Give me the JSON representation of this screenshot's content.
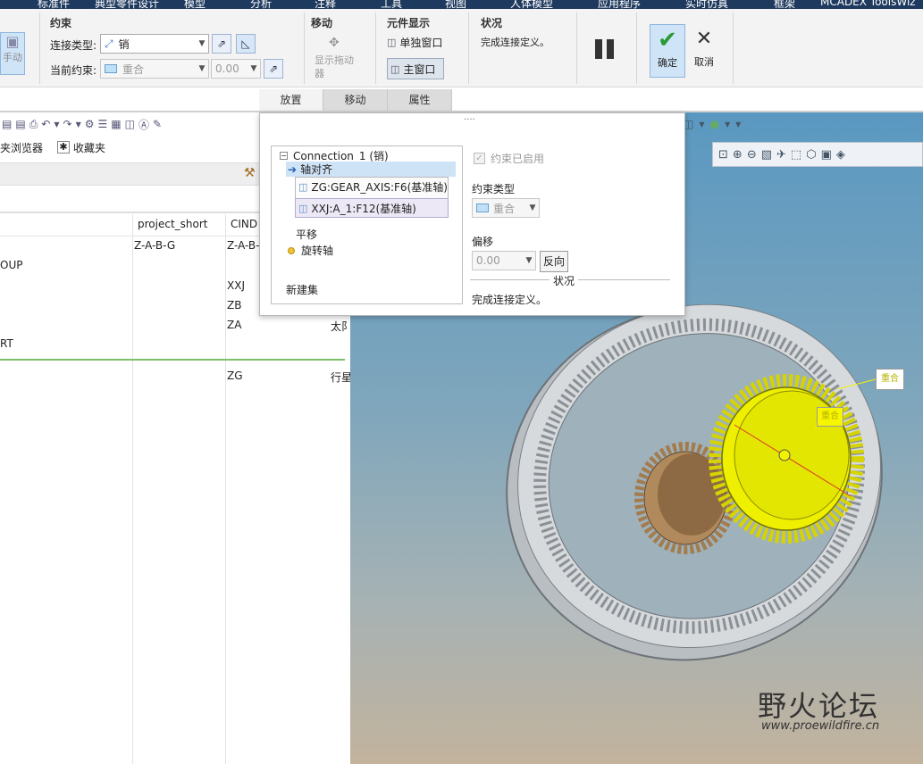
{
  "top_menu": [
    "标准件",
    "典型零件设计",
    "模型",
    "分析",
    "注释",
    "工具",
    "视图",
    "人体模型",
    "应用程序",
    "实时仿真",
    "框架",
    "MCADEX ToolsWiz"
  ],
  "ribbon": {
    "manual_btn_label": "手动",
    "constraint_group": {
      "title": "约束",
      "conn_type_label": "连接类型:",
      "conn_type_value": "销",
      "current_label": "当前约束:",
      "current_value": "重合",
      "offset_value": "0.00"
    },
    "move_group": {
      "title": "移动",
      "drag_label": "显示拖动器"
    },
    "component_display": {
      "title": "元件显示",
      "separate_window": "单独窗口",
      "main_window": "主窗口"
    },
    "status_group": {
      "title": "状况",
      "text": "完成连接定义。"
    },
    "pause_label": "",
    "ok_label": "确定",
    "cancel_label": "取消"
  },
  "tabs": [
    "放置",
    "移动",
    "属性"
  ],
  "tabs_handle": "····",
  "left": {
    "browser_tab": "夹浏览器",
    "favorites_tab": "收藏夹",
    "columns": [
      "project_short",
      "CIND"
    ],
    "rows": [
      {
        "c0": "",
        "c1": "Z-A-B-G",
        "c2": "Z-A-B-",
        "c3": ""
      },
      {
        "c0": "OUP",
        "c1": "",
        "c2": "",
        "c3": ""
      },
      {
        "c0": "",
        "c1": "",
        "c2": "XXJ",
        "c3": ""
      },
      {
        "c0": "",
        "c1": "",
        "c2": "ZB",
        "c3": ""
      },
      {
        "c0": "",
        "c1": "",
        "c2": "ZA",
        "c3": "太阝"
      },
      {
        "c0": "RT",
        "c1": "",
        "c2": "",
        "c3": ""
      },
      {
        "c0": "",
        "c1": "",
        "c2": "ZG",
        "c3": "行星"
      }
    ]
  },
  "placement": {
    "tree": {
      "root": "Connection_1 (销)",
      "selected": "轴对齐",
      "refs": [
        "ZG:GEAR_AXIS:F6(基准轴)",
        "XXJ:A_1:F12(基准轴)"
      ],
      "translate": "平移",
      "rotate": "旋转轴",
      "new_set": "新建集"
    },
    "enabled_label": "约束已启用",
    "type_label": "约束类型",
    "type_value": "重合",
    "offset_label": "偏移",
    "offset_value": "0.00",
    "flip_label": "反向",
    "status_title": "状况",
    "status_text": "完成连接定义。"
  },
  "viewport": {
    "callout_1": "重合",
    "callout_2": "重合",
    "watermark_cn": "野火论坛",
    "watermark_url": "www.proewildfire.cn"
  }
}
